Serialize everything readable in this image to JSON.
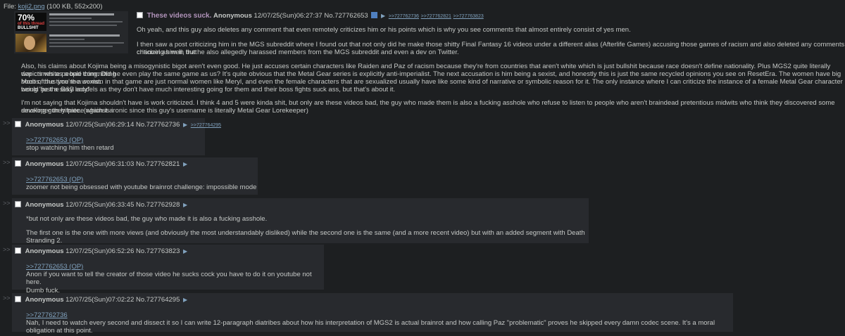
{
  "file": {
    "label": "File:",
    "filename": "koji2.png",
    "info": "(100 KB, 552x200)"
  },
  "thumbnail": {
    "big_text": "70%",
    "red_text": "of this thread",
    "bottom_text": "BULLSHIT"
  },
  "op": {
    "subject": "These videos suck.",
    "name": "Anonymous",
    "datetime": "12/07/25(Sun)06:27:37",
    "post_no": "No.727762653",
    "backlinks": [
      ">>727762736",
      ">>727762821",
      ">>727763823"
    ],
    "paragraphs": [
      "Oh yeah, and this guy also deletes any comment that even remotely criticizes him or his points which is why you see comments that almost entirely consist of yes men.",
      "I then saw a post criticizing him in the MGS subreddit where I found out that not only did he make those shitty Final Fantasy 16 videos under a different alias (Afterlife Games) accusing those games of racism and also deleted any comments criticizing him in that",
      "channel as well, but he also allegedly harassed members from the MGS subreddit and even a dev on Twitter.",
      "Also, his claims about Kojima being a misogynistic bigot aren't even good. He just accuses certain characters like Raiden and Paz of racism because they're from countries that aren't white which is just bullshit because race doesn't define nationality. Plus MGS2 quite literally depicts white people committing",
      "war crimes as a bad thing. Did he even play the same game as us? It's quite obvious that the Metal Gear series is explicitly anti-imperialist. The next accusation is him being a sexist, and honestly this is just the same recycled opinions you see on ResetEra. The women have big boobs, thus you're a sexist.",
      "Most of the time the women in that game are just normal women like Meryl, and even the female characters that are sexualized usually have like some kind of narrative or symbolic reason for it. The only instance where I can criticize the instance of a female Metal Gear character being \"just a sexy lady\"",
      "would be the B&B models as they don't have much interesting going for them and their boss fights suck ass, but that's about it.",
      "I'm not saying that Kojima shouldn't have is work criticized. I think 4 and 5 were kinda shit, but only are these videos bad, the guy who made them is also a fucking asshole who refuse to listen to people who aren't braindead pretentious midwits who think they discovered some smoking gun hitpiece against a",
      "developer they hate. (which is ironic since this guy's username is literally Metal Gear Lorekeeper)"
    ]
  },
  "reply_marker": ">>",
  "replies": [
    {
      "name": "Anonymous",
      "datetime": "12/07/25(Sun)06:29:14",
      "post_no": "No.727762736",
      "backlink": ">>727764295",
      "quote": ">>727762653 (OP)",
      "lines": [
        "stop watching him then retard"
      ]
    },
    {
      "name": "Anonymous",
      "datetime": "12/07/25(Sun)06:31:03",
      "post_no": "No.727762821",
      "backlink": "",
      "quote": ">>727762653 (OP)",
      "lines": [
        "zoomer not being obsessed with youtube brainrot challenge: impossible mode"
      ]
    },
    {
      "name": "Anonymous",
      "datetime": "12/07/25(Sun)06:33:45",
      "post_no": "No.727762928",
      "backlink": "",
      "quote": "",
      "lines": [
        "*but not only are these videos bad, the guy who made it is also a fucking asshole.",
        "The first one is the one with more views (and obviously the most understandably disliked) while the second one is the same (and a more recent video) but with an added segment with Death Stranding 2."
      ]
    },
    {
      "name": "Anonymous",
      "datetime": "12/07/25(Sun)06:52:26",
      "post_no": "No.727763823",
      "backlink": "",
      "quote": ">>727762653 (OP)",
      "lines": [
        "Anon if you want to tell the creator of those video he sucks cock you have to do it on youtube not here.",
        "Dumb fuck."
      ]
    },
    {
      "name": "Anonymous",
      "datetime": "12/07/25(Sun)07:02:22",
      "post_no": "No.727764295",
      "backlink": "",
      "quote": ">>727762736",
      "lines": [
        "Nah, I need to watch every second and dissect it so I can write 12-paragraph diatribes about how his interpretation of MGS2 is actual brainrot and how calling Paz \"problematic\" proves he skipped every damn codec scene. It's a moral obligation at this point."
      ]
    }
  ]
}
